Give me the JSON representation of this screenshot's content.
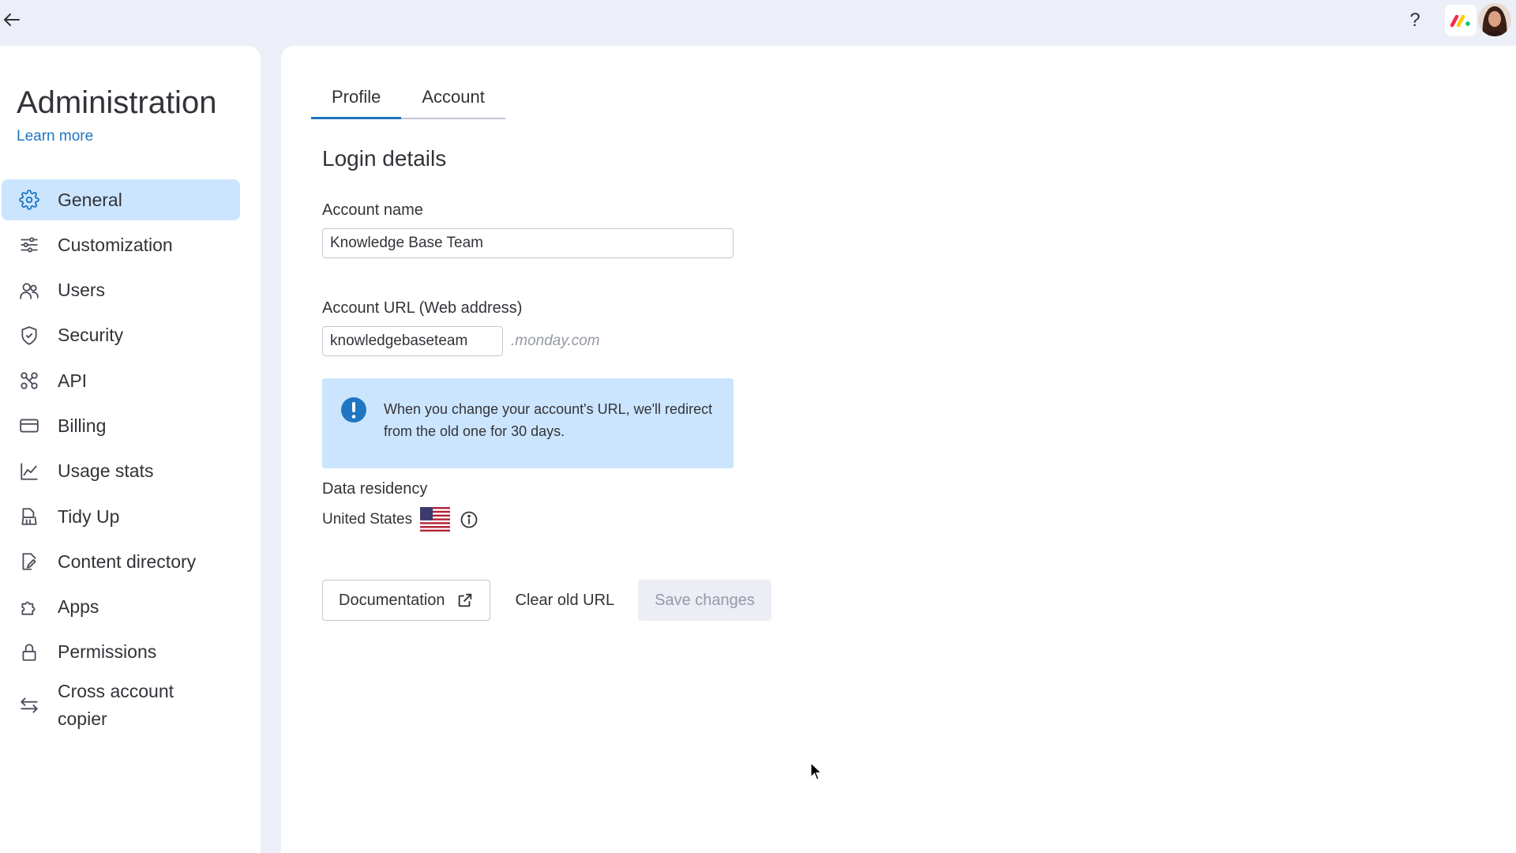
{
  "sidebar": {
    "title": "Administration",
    "learn_more": "Learn more",
    "items": [
      {
        "label": "General",
        "icon": "gear-icon",
        "active": true
      },
      {
        "label": "Customization",
        "icon": "sliders-icon"
      },
      {
        "label": "Users",
        "icon": "users-icon"
      },
      {
        "label": "Security",
        "icon": "shield-icon"
      },
      {
        "label": "API",
        "icon": "api-icon"
      },
      {
        "label": "Billing",
        "icon": "credit-card-icon"
      },
      {
        "label": "Usage stats",
        "icon": "line-chart-icon"
      },
      {
        "label": "Tidy Up",
        "icon": "broom-icon"
      },
      {
        "label": "Content directory",
        "icon": "document-edit-icon"
      },
      {
        "label": "Apps",
        "icon": "puzzle-icon"
      },
      {
        "label": "Permissions",
        "icon": "lock-icon"
      },
      {
        "label": "Cross account copier",
        "icon": "swap-arrows-icon"
      }
    ]
  },
  "tabs": [
    {
      "label": "Profile",
      "active": true
    },
    {
      "label": "Account",
      "active": false
    }
  ],
  "main": {
    "section_title": "Login details",
    "account_name_label": "Account name",
    "account_name_value": "Knowledge Base Team",
    "account_url_label": "Account URL (Web address)",
    "account_url_value": "knowledgebaseteam",
    "url_suffix": ".monday.com",
    "notice_text": "When you change your account's URL, we'll redirect from the old one for 30 days.",
    "data_residency_label": "Data residency",
    "data_residency_value": "United States"
  },
  "buttons": {
    "documentation": "Documentation",
    "clear_old_url": "Clear old URL",
    "save_changes": "Save changes"
  },
  "topbar": {
    "help": "?"
  },
  "colors": {
    "accent": "#1f76c2",
    "selected_bg": "#cce5ff",
    "page_bg": "#eceff8",
    "disabled_bg": "#ecedf5",
    "disabled_text": "#9699a6"
  }
}
